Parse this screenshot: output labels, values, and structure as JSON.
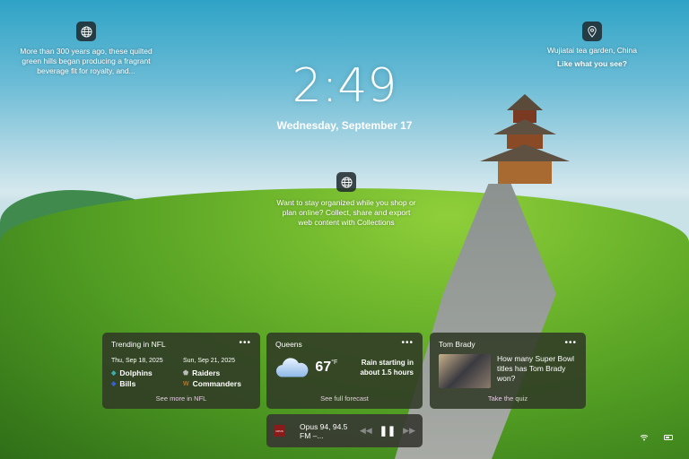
{
  "spotlight": {
    "left_caption": "More than 300 years ago, these quilted green hills began producing a fragrant beverage fit for royalty, and...",
    "location": "Wujiatai tea garden, China",
    "like_prompt": "Like what you see?",
    "tip": "Want to stay organized while you shop or plan online? Collect, share and export web content with Collections"
  },
  "clock": {
    "time": "2:49",
    "date": "Wednesday, September 17"
  },
  "nfl": {
    "title": "Trending in NFL",
    "games": [
      {
        "date": "Thu, Sep 18, 2025",
        "team1": "Dolphins",
        "team2": "Bills"
      },
      {
        "date": "Sun, Sep 21, 2025",
        "team1": "Raiders",
        "team2": "Commanders"
      }
    ],
    "link": "See more in NFL"
  },
  "weather": {
    "title": "Queens",
    "temp": "67",
    "unit": "°F",
    "summary": "Rain starting in about 1.5 hours",
    "link": "See full forecast"
  },
  "news": {
    "title": "Tom Brady",
    "question": "How many Super Bowl titles has Tom Brady won?",
    "link": "Take the quiz"
  },
  "media": {
    "track": "Opus 94, 94.5 FM –...",
    "logo": "OPUS"
  },
  "more_label": "•••"
}
